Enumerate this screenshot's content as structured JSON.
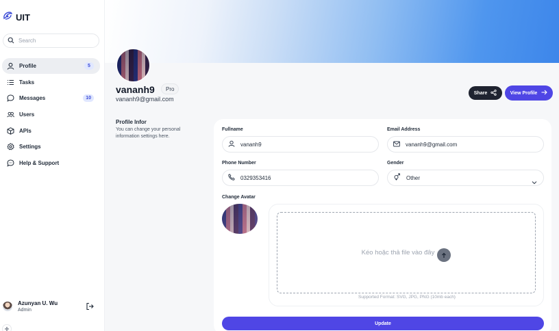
{
  "app": {
    "title": "UIT"
  },
  "search": {
    "placeholder": "Search"
  },
  "sidebar": {
    "items": [
      {
        "label": "Profile",
        "icon": "user-icon",
        "badge": "5",
        "active": true
      },
      {
        "label": "Tasks",
        "icon": "list-icon"
      },
      {
        "label": "Messages",
        "icon": "chat-icon",
        "badge": "10"
      },
      {
        "label": "Users",
        "icon": "users-icon"
      },
      {
        "label": "APIs",
        "icon": "cube-icon"
      },
      {
        "label": "Settings",
        "icon": "gear-icon"
      },
      {
        "label": "Help & Support",
        "icon": "help-chat-icon"
      }
    ]
  },
  "user": {
    "name": "Azunyan U. Wu",
    "role": "Admin"
  },
  "profile": {
    "name": "vananh9",
    "plan": "Pro",
    "email": "vananh9@gmail.com",
    "share_label": "Share",
    "view_profile_label": "View Profile"
  },
  "section": {
    "title": "Profile Infor",
    "description": "You can change your personal information settings here."
  },
  "form": {
    "fullname": {
      "label": "Fullname",
      "value": "vananh9"
    },
    "email": {
      "label": "Email Address",
      "value": "vananh9@gmail.com"
    },
    "phone": {
      "label": "Phone Number",
      "value": "0329353416"
    },
    "gender": {
      "label": "Gender",
      "value": "Other"
    },
    "avatar": {
      "label": "Change Avatar",
      "drop_text": "Kéo hoặc thả file vào đây",
      "support_text": "Supported Format: SVG, JPG, PNG (10mb each)"
    },
    "update_label": "Update"
  },
  "colors": {
    "accent": "#4f46e5",
    "dark_button": "#1f2330",
    "badge_bg": "#e0e7ff"
  }
}
